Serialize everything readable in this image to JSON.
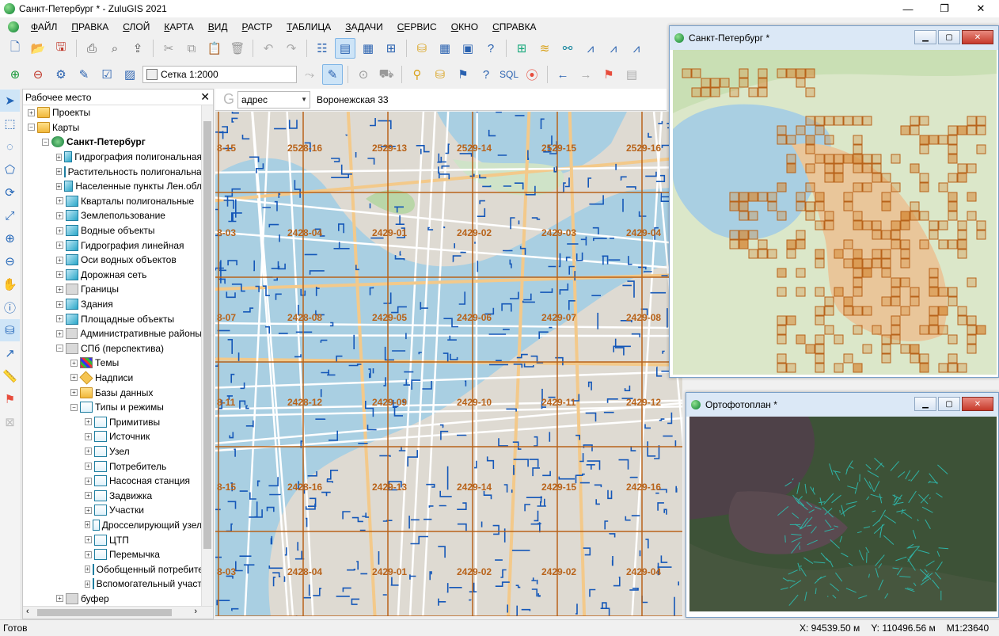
{
  "window": {
    "title": "Санкт-Петербург * - ZuluGIS 2021",
    "controls": [
      "—",
      "❐",
      "✕"
    ]
  },
  "menu": [
    "ФАЙЛ",
    "ПРАВКА",
    "СЛОЙ",
    "КАРТА",
    "ВИД",
    "РАСТР",
    "ТАБЛИЦА",
    "ЗАДАЧИ",
    "СЕРВИС",
    "ОКНО",
    "СПРАВКА"
  ],
  "toolbar2": {
    "grid_combo_value": "Сетка 1:2000"
  },
  "workspace": {
    "title": "Рабочее место",
    "close": "✕",
    "tree": [
      {
        "label": "Проекты",
        "level": 0,
        "exp": "+",
        "icon": "folder"
      },
      {
        "label": "Карты",
        "level": 0,
        "exp": "−",
        "icon": "folder"
      },
      {
        "label": "Санкт-Петербург",
        "level": 1,
        "exp": "−",
        "icon": "map",
        "bold": true
      },
      {
        "label": "Гидрография полигональная",
        "level": 2,
        "exp": "+",
        "icon": "layer"
      },
      {
        "label": "Растительность полигональная",
        "level": 2,
        "exp": "+",
        "icon": "layer"
      },
      {
        "label": "Населенные пункты Лен.обл",
        "level": 2,
        "exp": "+",
        "icon": "layer"
      },
      {
        "label": "Кварталы полигональные",
        "level": 2,
        "exp": "+",
        "icon": "layer"
      },
      {
        "label": "Землепользование",
        "level": 2,
        "exp": "+",
        "icon": "layer"
      },
      {
        "label": "Водные объекты",
        "level": 2,
        "exp": "+",
        "icon": "layer"
      },
      {
        "label": "Гидрография линейная",
        "level": 2,
        "exp": "+",
        "icon": "layer"
      },
      {
        "label": "Оси водных объектов",
        "level": 2,
        "exp": "+",
        "icon": "layer"
      },
      {
        "label": "Дорожная сеть",
        "level": 2,
        "exp": "+",
        "icon": "layer"
      },
      {
        "label": "Границы",
        "level": 2,
        "exp": "+",
        "icon": "grey"
      },
      {
        "label": "Здания",
        "level": 2,
        "exp": "+",
        "icon": "layer"
      },
      {
        "label": "Площадные объекты",
        "level": 2,
        "exp": "+",
        "icon": "layer"
      },
      {
        "label": "Административные районы",
        "level": 2,
        "exp": "+",
        "icon": "grey"
      },
      {
        "label": "СПб (перспектива)",
        "level": 2,
        "exp": "−",
        "icon": "grey"
      },
      {
        "label": "Темы",
        "level": 3,
        "exp": "+",
        "icon": "theme"
      },
      {
        "label": "Надписи",
        "level": 3,
        "exp": "+",
        "icon": "tag"
      },
      {
        "label": "Базы данных",
        "level": 3,
        "exp": "+",
        "icon": "folder"
      },
      {
        "label": "Типы и режимы",
        "level": 3,
        "exp": "−",
        "icon": "type"
      },
      {
        "label": "Примитивы",
        "level": 4,
        "exp": "+",
        "icon": "type"
      },
      {
        "label": "Источник",
        "level": 4,
        "exp": "+",
        "icon": "type"
      },
      {
        "label": "Узел",
        "level": 4,
        "exp": "+",
        "icon": "type"
      },
      {
        "label": "Потребитель",
        "level": 4,
        "exp": "+",
        "icon": "type"
      },
      {
        "label": "Насосная станция",
        "level": 4,
        "exp": "+",
        "icon": "type"
      },
      {
        "label": "Задвижка",
        "level": 4,
        "exp": "+",
        "icon": "type"
      },
      {
        "label": "Участки",
        "level": 4,
        "exp": "+",
        "icon": "type"
      },
      {
        "label": "Дросселирующий узел",
        "level": 4,
        "exp": "+",
        "icon": "type"
      },
      {
        "label": "ЦТП",
        "level": 4,
        "exp": "+",
        "icon": "type"
      },
      {
        "label": "Перемычка",
        "level": 4,
        "exp": "+",
        "icon": "type"
      },
      {
        "label": "Обобщенный потребитель",
        "level": 4,
        "exp": "+",
        "icon": "type"
      },
      {
        "label": "Вспомогательный участок",
        "level": 4,
        "exp": "+",
        "icon": "type"
      },
      {
        "label": "буфер",
        "level": 2,
        "exp": "+",
        "icon": "grey"
      }
    ]
  },
  "search": {
    "mode": "адрес",
    "query": "Воронежская 33"
  },
  "main_map": {
    "grid_labels": [
      [
        "8-15",
        "2528-16",
        "2529-13",
        "2529-14",
        "2529-15",
        "2529-16"
      ],
      [
        "8-03",
        "2428-04",
        "2429-01",
        "2429-02",
        "2429-03",
        "2429-04"
      ],
      [
        "8-07",
        "2428-08",
        "2429-05",
        "2429-06",
        "2429-07",
        "2429-08"
      ],
      [
        "8-11",
        "2428-12",
        "2429-09",
        "2429-10",
        "2429-11",
        "2429-12"
      ],
      [
        "8-15",
        "2428-16",
        "2429-13",
        "2429-14",
        "2429-15",
        "2429-16"
      ],
      [
        "8-03",
        "2428-04",
        "2429-01",
        "2429-02",
        "2429-02",
        "2429-04"
      ]
    ],
    "colors": {
      "water": "#a9cfe2",
      "land": "#dedad2",
      "roads": "#ffffff",
      "pipes": "#1457b8",
      "grid": "#b8631a"
    }
  },
  "overview_window": {
    "title": "Санкт-Петербург *"
  },
  "ortho_window": {
    "title": "Ортофотоплан *"
  },
  "status": {
    "ready": "Готов",
    "x": "X:  94539.50 м",
    "y": "Y: 110496.56 м",
    "scale": "M1:23640"
  }
}
